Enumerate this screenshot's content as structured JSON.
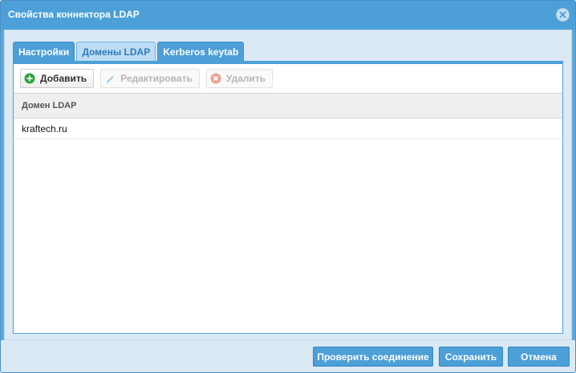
{
  "window": {
    "title": "Свойства коннектора LDAP"
  },
  "tabs": [
    {
      "label": "Настройки"
    },
    {
      "label": "Домены LDAP",
      "active": true
    },
    {
      "label": "Kerberos keytab"
    }
  ],
  "toolbar": {
    "add_label": "Добавить",
    "edit_label": "Редактировать",
    "delete_label": "Удалить"
  },
  "grid": {
    "columns": [
      "Домен LDAP"
    ],
    "rows": [
      {
        "domain": "kraftech.ru"
      }
    ]
  },
  "footer": {
    "test_label": "Проверить соединение",
    "save_label": "Сохранить",
    "cancel_label": "Отмена"
  },
  "colors": {
    "accent": "#4c9fd7",
    "add_icon": "#2ea043",
    "delete_icon": "#f0a090"
  },
  "icons": {
    "close": "close-icon",
    "add": "plus-circle-icon",
    "edit": "pencil-icon",
    "delete": "x-circle-icon"
  }
}
